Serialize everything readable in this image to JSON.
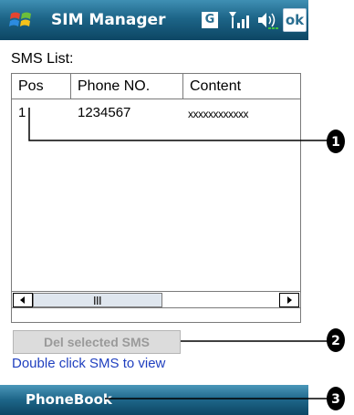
{
  "titlebar": {
    "title": "SIM Manager",
    "g_label": "G",
    "ok_label": "ok",
    "icons": [
      "windows-start-icon",
      "gprs-icon",
      "signal-icon",
      "volume-icon"
    ]
  },
  "sms_list": {
    "label": "SMS List:",
    "columns": [
      "Pos",
      "Phone NO.",
      "Content"
    ],
    "rows": [
      {
        "pos": "1",
        "phone": "1234567",
        "content": "xxxxxxxxxxxx"
      }
    ]
  },
  "buttons": {
    "delete_label": "Del selected SMS"
  },
  "hint": "Double click SMS to view",
  "softkeys": {
    "left": "PhoneBook"
  },
  "callouts": [
    "1",
    "2",
    "3"
  ]
}
